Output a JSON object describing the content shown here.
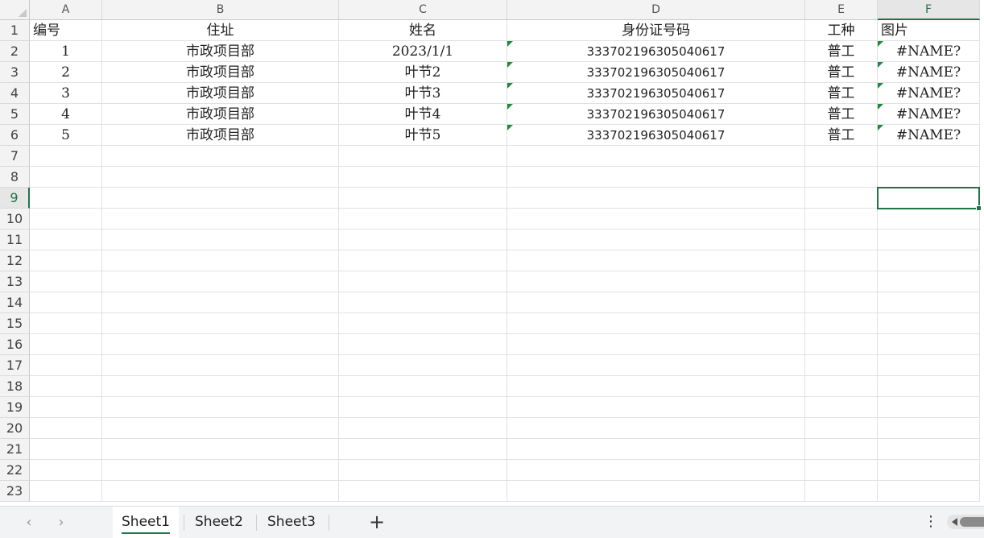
{
  "columns": [
    "A",
    "B",
    "C",
    "D",
    "E",
    "F"
  ],
  "selected_column": "F",
  "selected_row": "9",
  "rows": [
    {
      "num": "1",
      "cells": [
        "编号",
        "住址",
        "姓名",
        "身份证号码",
        "工种",
        "图片"
      ]
    },
    {
      "num": "2",
      "cells": [
        "1",
        "市政项目部",
        "2023/1/1",
        "333702196305040617",
        "普工",
        "#NAME?"
      ]
    },
    {
      "num": "3",
      "cells": [
        "2",
        "市政项目部",
        "叶节2",
        "333702196305040617",
        "普工",
        "#NAME?"
      ]
    },
    {
      "num": "4",
      "cells": [
        "3",
        "市政项目部",
        "叶节3",
        "333702196305040617",
        "普工",
        "#NAME?"
      ]
    },
    {
      "num": "5",
      "cells": [
        "4",
        "市政项目部",
        "叶节4",
        "333702196305040617",
        "普工",
        "#NAME?"
      ]
    },
    {
      "num": "6",
      "cells": [
        "5",
        "市政项目部",
        "叶节5",
        "333702196305040617",
        "普工",
        "#NAME?"
      ]
    },
    {
      "num": "7",
      "cells": [
        "",
        "",
        "",
        "",
        "",
        ""
      ]
    },
    {
      "num": "8",
      "cells": [
        "",
        "",
        "",
        "",
        "",
        ""
      ]
    },
    {
      "num": "9",
      "cells": [
        "",
        "",
        "",
        "",
        "",
        ""
      ]
    },
    {
      "num": "10",
      "cells": [
        "",
        "",
        "",
        "",
        "",
        ""
      ]
    },
    {
      "num": "11",
      "cells": [
        "",
        "",
        "",
        "",
        "",
        ""
      ]
    },
    {
      "num": "12",
      "cells": [
        "",
        "",
        "",
        "",
        "",
        ""
      ]
    },
    {
      "num": "13",
      "cells": [
        "",
        "",
        "",
        "",
        "",
        ""
      ]
    },
    {
      "num": "14",
      "cells": [
        "",
        "",
        "",
        "",
        "",
        ""
      ]
    },
    {
      "num": "15",
      "cells": [
        "",
        "",
        "",
        "",
        "",
        ""
      ]
    },
    {
      "num": "16",
      "cells": [
        "",
        "",
        "",
        "",
        "",
        ""
      ]
    },
    {
      "num": "17",
      "cells": [
        "",
        "",
        "",
        "",
        "",
        ""
      ]
    },
    {
      "num": "18",
      "cells": [
        "",
        "",
        "",
        "",
        "",
        ""
      ]
    },
    {
      "num": "19",
      "cells": [
        "",
        "",
        "",
        "",
        "",
        ""
      ]
    },
    {
      "num": "20",
      "cells": [
        "",
        "",
        "",
        "",
        "",
        ""
      ]
    },
    {
      "num": "21",
      "cells": [
        "",
        "",
        "",
        "",
        "",
        ""
      ]
    },
    {
      "num": "22",
      "cells": [
        "",
        "",
        "",
        "",
        "",
        ""
      ]
    },
    {
      "num": "23",
      "cells": [
        "",
        "",
        "",
        "",
        "",
        ""
      ]
    }
  ],
  "sheet_tabs": [
    "Sheet1",
    "Sheet2",
    "Sheet3"
  ],
  "active_tab": "Sheet1",
  "icons": {
    "prev_sheet": "chevron-left-icon",
    "next_sheet": "chevron-right-icon",
    "add_sheet": "plus-icon",
    "more": "more-vertical-icon",
    "text_number_indicator": "green-triangle-icon"
  },
  "colors": {
    "accent": "#217346",
    "error_indicator": "#1e8a3c"
  }
}
